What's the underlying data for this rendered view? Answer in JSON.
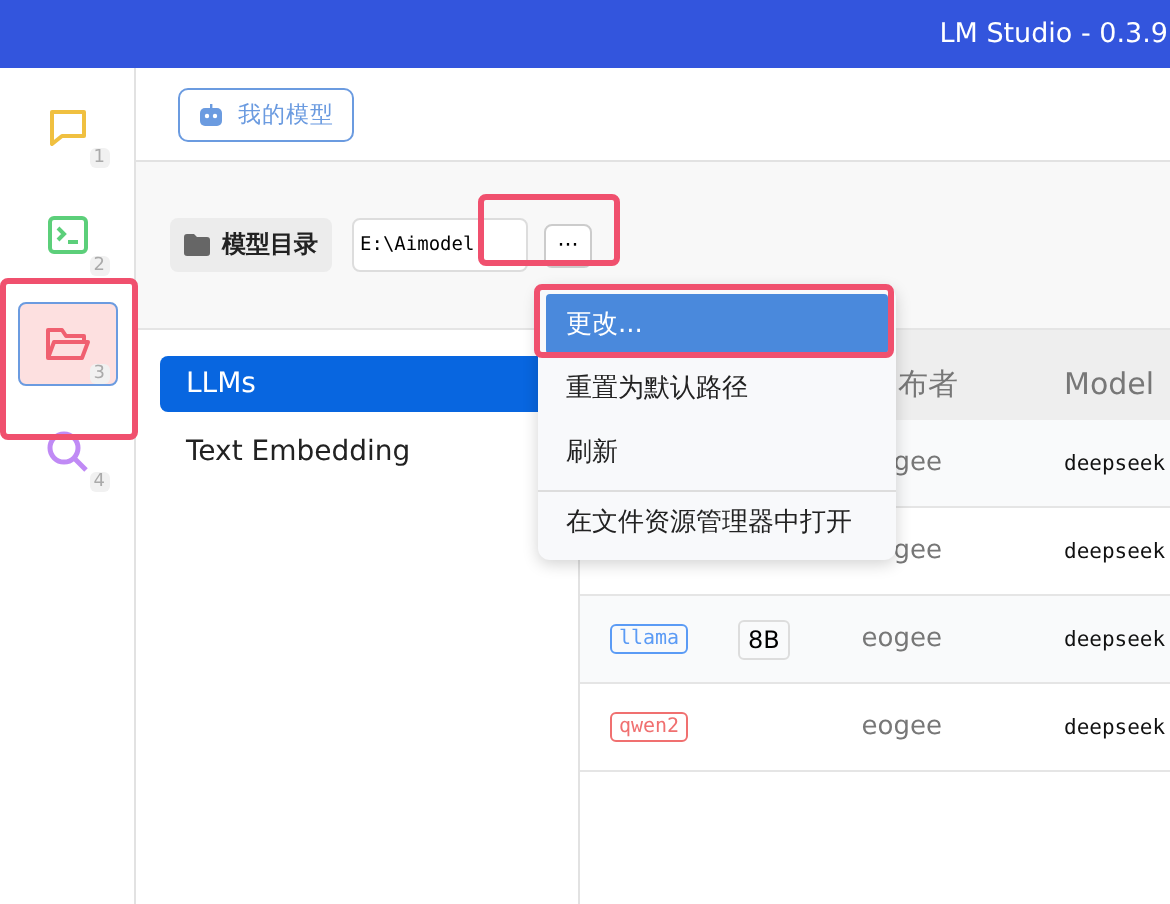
{
  "window": {
    "title": "LM Studio - 0.3.9"
  },
  "nav": [
    {
      "kind": "chat",
      "badge": "1",
      "selected": false,
      "highlighted": false
    },
    {
      "kind": "terminal",
      "badge": "2",
      "selected": false,
      "highlighted": false
    },
    {
      "kind": "folder",
      "badge": "3",
      "selected": true,
      "highlighted": true
    },
    {
      "kind": "search",
      "badge": "4",
      "selected": false,
      "highlighted": false
    }
  ],
  "header": {
    "tab": "我的模型"
  },
  "toolbar": {
    "label": "模型目录",
    "path": "E:\\Aimodel",
    "more_button": {
      "label": "···",
      "highlighted": true
    }
  },
  "categories": [
    {
      "label": "LLMs",
      "selected": true
    },
    {
      "label": "Text Embedding",
      "selected": false
    }
  ],
  "table": {
    "columns": [
      "布者",
      "Model"
    ],
    "rows": [
      {
        "publisher": "gee",
        "model": "deepseek"
      },
      {
        "publisher": "gee",
        "model": "deepseek"
      },
      {
        "tag": {
          "label": "llama",
          "color": "#5b9bf5"
        },
        "size": "8B",
        "publisher": "eogee",
        "model": "deepseek"
      },
      {
        "tag": {
          "label": "qwen2",
          "color": "#f07070"
        },
        "publisher": "eogee",
        "model": "deepseek"
      }
    ]
  },
  "menu": {
    "items": [
      {
        "label": "更改...",
        "selected": true,
        "highlighted": true,
        "separated": false
      },
      {
        "label": "重置为默认路径",
        "selected": false,
        "highlighted": false,
        "separated": false
      },
      {
        "label": "刷新",
        "selected": false,
        "highlighted": false,
        "separated": false
      },
      {
        "label": "在文件资源管理器中打开",
        "selected": false,
        "highlighted": false,
        "separated": true
      }
    ]
  }
}
